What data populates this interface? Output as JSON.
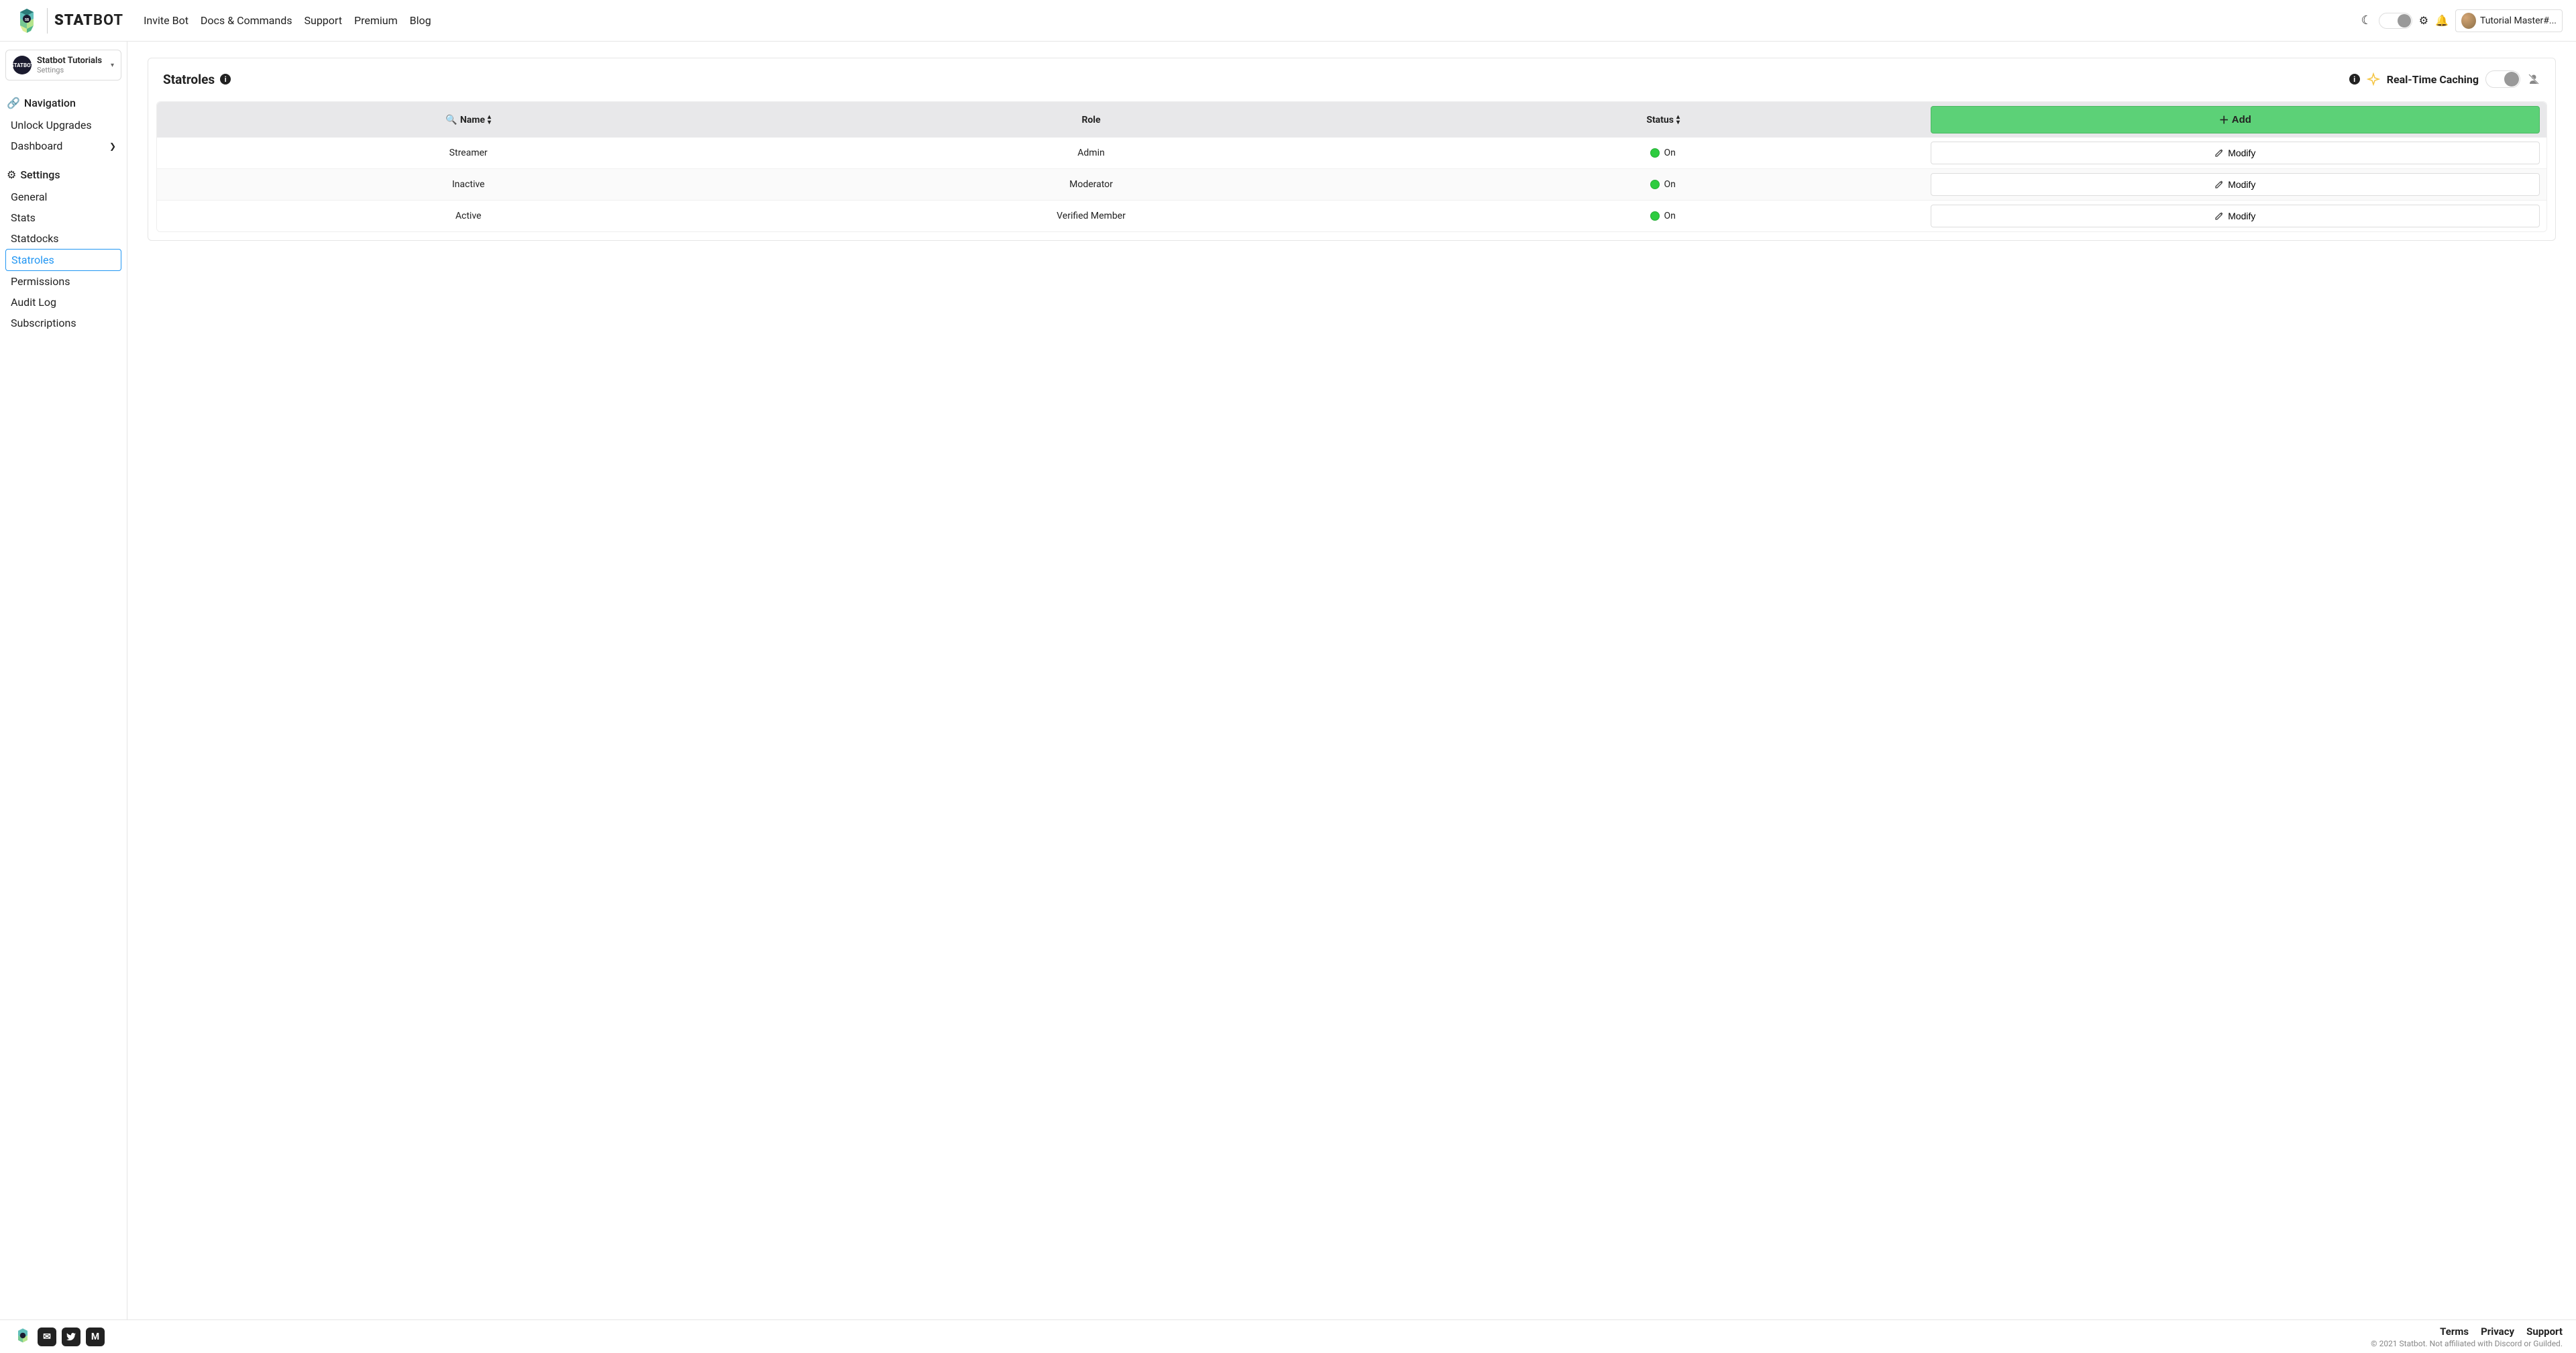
{
  "brand": {
    "name_bold": "STAT",
    "name_light": "BOT"
  },
  "nav": {
    "invite": "Invite Bot",
    "docs": "Docs & Commands",
    "support": "Support",
    "premium": "Premium",
    "blog": "Blog"
  },
  "user": {
    "name": "Tutorial Master#..."
  },
  "server": {
    "name": "Statbot Tutorials",
    "sub": "Settings"
  },
  "sidebar": {
    "nav_header": "Navigation",
    "unlock": "Unlock Upgrades",
    "dashboard": "Dashboard",
    "settings_header": "Settings",
    "general": "General",
    "stats": "Stats",
    "statdocks": "Statdocks",
    "statroles": "Statroles",
    "permissions": "Permissions",
    "audit": "Audit Log",
    "subscriptions": "Subscriptions"
  },
  "panel": {
    "title": "Statroles",
    "caching_label": "Real-Time Caching"
  },
  "table": {
    "headers": {
      "name": "Name",
      "role": "Role",
      "status": "Status"
    },
    "add_label": "Add",
    "modify_label": "Modify",
    "rows": [
      {
        "name": "Streamer",
        "role": "Admin",
        "status": "On"
      },
      {
        "name": "Inactive",
        "role": "Moderator",
        "status": "On"
      },
      {
        "name": "Active",
        "role": "Verified Member",
        "status": "On"
      }
    ]
  },
  "footer": {
    "terms": "Terms",
    "privacy": "Privacy",
    "support": "Support",
    "copy": "© 2021 Statbot. Not affiliated with Discord or Guilded."
  }
}
